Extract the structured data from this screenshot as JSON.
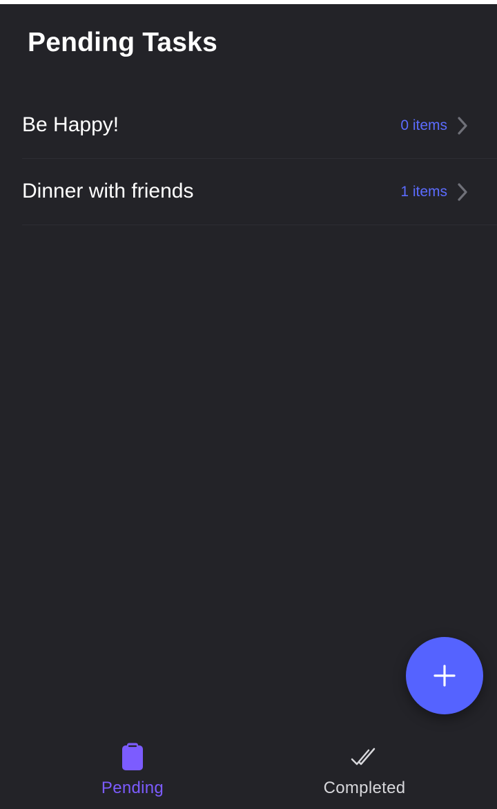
{
  "header": {
    "title": "Pending Tasks"
  },
  "tasks": [
    {
      "title": "Be Happy!",
      "count_label": "0 items"
    },
    {
      "title": "Dinner with friends",
      "count_label": "1 items"
    }
  ],
  "fab": {
    "icon": "plus-icon"
  },
  "bottom_nav": {
    "items": [
      {
        "label": "Pending",
        "icon": "clipboard-icon",
        "active": true
      },
      {
        "label": "Completed",
        "icon": "double-check-icon",
        "active": false
      }
    ]
  },
  "colors": {
    "background": "#232328",
    "text_primary": "#ffffff",
    "count_text": "#5c6cff",
    "fab": "#5563ff",
    "active_tab": "#7c5cff",
    "inactive_tab": "#d7d7db",
    "divider": "#2d2d34",
    "chevron": "#6f7078"
  }
}
